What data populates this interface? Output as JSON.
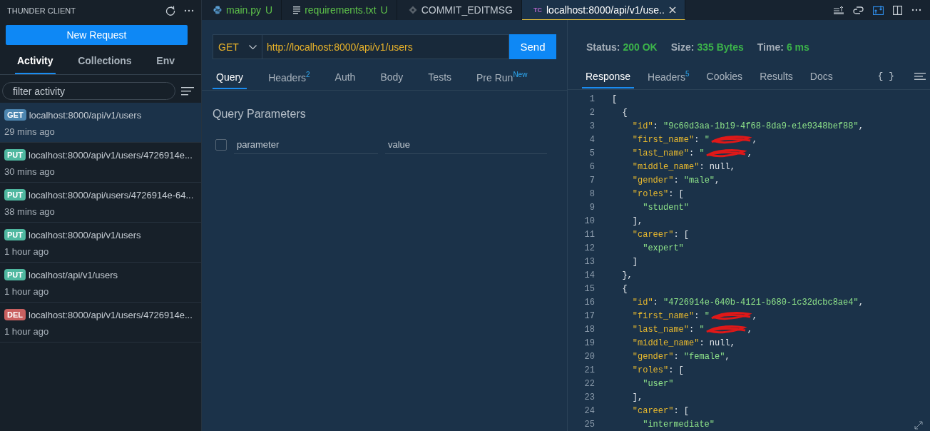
{
  "sidebar": {
    "title": "THUNDER CLIENT",
    "new_request": "New Request",
    "tabs": [
      {
        "label": "Activity",
        "selected": true
      },
      {
        "label": "Collections",
        "selected": false
      },
      {
        "label": "Env",
        "selected": false
      }
    ],
    "filter": {
      "placeholder": "filter activity"
    },
    "activity": [
      {
        "method": "GET",
        "url": "localhost:8000/api/v1/users",
        "time": "29 mins ago",
        "selected": true,
        "color": "#4d86b0"
      },
      {
        "method": "PUT",
        "url": "localhost:8000/api/v1/users/4726914e...",
        "time": "30 mins ago",
        "selected": false,
        "color": "#4fb8a0"
      },
      {
        "method": "PUT",
        "url": "localhost:8000/api/users/4726914e-64...",
        "time": "38 mins ago",
        "selected": false,
        "color": "#4fb8a0"
      },
      {
        "method": "PUT",
        "url": "localhost:8000/api/v1/users",
        "time": "1 hour ago",
        "selected": false,
        "color": "#4fb8a0"
      },
      {
        "method": "PUT",
        "url": "localhost/api/v1/users",
        "time": "1 hour ago",
        "selected": false,
        "color": "#4fb8a0"
      },
      {
        "method": "DEL",
        "url": "localhost:8000/api/v1/users/4726914e...",
        "time": "1 hour ago",
        "selected": false,
        "color": "#c96060"
      }
    ]
  },
  "editor_tabs": [
    {
      "kind": "python",
      "label": "main.py",
      "status": "U",
      "selected": false
    },
    {
      "kind": "text",
      "label": "requirements.txt",
      "status": "U",
      "selected": false
    },
    {
      "kind": "git",
      "label": "COMMIT_EDITMSG",
      "selected": false
    },
    {
      "kind": "thunder",
      "badge": "TC",
      "label": "localhost:8000/api/v1/use..",
      "selected": true
    }
  ],
  "request": {
    "method": "GET",
    "url": "http://localhost:8000/api/v1/users",
    "send": "Send",
    "tabs": [
      {
        "label": "Query",
        "selected": true
      },
      {
        "label": "Headers$^{2}$",
        "selected": false
      },
      {
        "label": "Auth",
        "selected": false
      },
      {
        "label": "Body",
        "selected": false
      },
      {
        "label": "Tests",
        "selected": false
      },
      {
        "label": "Pre Run$^{New}$",
        "selected": false
      }
    ],
    "section_title": "Query Parameters",
    "param_row": {
      "checked": false,
      "name_placeholder": "parameter",
      "value_placeholder": "value"
    }
  },
  "response": {
    "stats": [
      {
        "label": "Status:",
        "value": "200 OK"
      },
      {
        "label": "Size:",
        "value": "335 Bytes"
      },
      {
        "label": "Time:",
        "value": "6 ms"
      }
    ],
    "tabs": [
      {
        "label": "Response",
        "selected": true
      },
      {
        "label": "Headers$^{5}$",
        "selected": false
      },
      {
        "label": "Cookies",
        "selected": false
      },
      {
        "label": "Results",
        "selected": false
      },
      {
        "label": "Docs",
        "selected": false
      }
    ],
    "format_button": "{ }",
    "lines": [
      {
        "number": "1",
        "tokens": [
          {
            "kind": "punct",
            "text": "["
          }
        ]
      },
      {
        "number": "2",
        "tokens": [
          {
            "kind": "punct",
            "text": "  {"
          }
        ]
      },
      {
        "number": "3",
        "tokens": [
          {
            "kind": "key",
            "text": "    \"id\""
          },
          {
            "kind": "punct",
            "text": ": "
          },
          {
            "kind": "string",
            "text": "\"9c60d3aa-1b19-4f68-8da9-e1e9348bef88\""
          },
          {
            "kind": "punct",
            "text": ","
          }
        ]
      },
      {
        "number": "4",
        "tokens": [
          {
            "kind": "key",
            "text": "    \"first_name\""
          },
          {
            "kind": "punct",
            "text": ": "
          },
          {
            "kind": "string",
            "text": "\""
          },
          {
            "kind": "redacted"
          },
          {
            "kind": "punct",
            "text": ","
          }
        ]
      },
      {
        "number": "5",
        "tokens": [
          {
            "kind": "key",
            "text": "    \"last_name\""
          },
          {
            "kind": "punct",
            "text": ": "
          },
          {
            "kind": "string",
            "text": "\""
          },
          {
            "kind": "redacted"
          },
          {
            "kind": "punct",
            "text": ","
          }
        ]
      },
      {
        "number": "6",
        "tokens": [
          {
            "kind": "key",
            "text": "    \"middle_name\""
          },
          {
            "kind": "punct",
            "text": ": null,"
          }
        ]
      },
      {
        "number": "7",
        "tokens": [
          {
            "kind": "key",
            "text": "    \"gender\""
          },
          {
            "kind": "punct",
            "text": ": "
          },
          {
            "kind": "string",
            "text": "\"male\""
          },
          {
            "kind": "punct",
            "text": ","
          }
        ]
      },
      {
        "number": "8",
        "tokens": [
          {
            "kind": "key",
            "text": "    \"roles\""
          },
          {
            "kind": "punct",
            "text": ": ["
          }
        ]
      },
      {
        "number": "9",
        "tokens": [
          {
            "kind": "string",
            "text": "      \"student\""
          }
        ]
      },
      {
        "number": "10",
        "tokens": [
          {
            "kind": "punct",
            "text": "    ],"
          }
        ]
      },
      {
        "number": "11",
        "tokens": [
          {
            "kind": "key",
            "text": "    \"career\""
          },
          {
            "kind": "punct",
            "text": ": ["
          }
        ]
      },
      {
        "number": "12",
        "tokens": [
          {
            "kind": "string",
            "text": "      \"expert\""
          }
        ]
      },
      {
        "number": "13",
        "tokens": [
          {
            "kind": "punct",
            "text": "    ]"
          }
        ]
      },
      {
        "number": "14",
        "tokens": [
          {
            "kind": "punct",
            "text": "  },"
          }
        ]
      },
      {
        "number": "15",
        "tokens": [
          {
            "kind": "punct",
            "text": "  {"
          }
        ]
      },
      {
        "number": "16",
        "tokens": [
          {
            "kind": "key",
            "text": "    \"id\""
          },
          {
            "kind": "punct",
            "text": ": "
          },
          {
            "kind": "string",
            "text": "\"4726914e-640b-4121-b680-1c32dcbc8ae4\""
          },
          {
            "kind": "punct",
            "text": ","
          }
        ]
      },
      {
        "number": "17",
        "tokens": [
          {
            "kind": "key",
            "text": "    \"first_name\""
          },
          {
            "kind": "punct",
            "text": ": "
          },
          {
            "kind": "string",
            "text": "\""
          },
          {
            "kind": "redacted"
          },
          {
            "kind": "punct",
            "text": ","
          }
        ]
      },
      {
        "number": "18",
        "tokens": [
          {
            "kind": "key",
            "text": "    \"last_name\""
          },
          {
            "kind": "punct",
            "text": ": "
          },
          {
            "kind": "string",
            "text": "\""
          },
          {
            "kind": "redacted"
          },
          {
            "kind": "punct",
            "text": ","
          }
        ]
      },
      {
        "number": "19",
        "tokens": [
          {
            "kind": "key",
            "text": "    \"middle_name\""
          },
          {
            "kind": "punct",
            "text": ": null,"
          }
        ]
      },
      {
        "number": "20",
        "tokens": [
          {
            "kind": "key",
            "text": "    \"gender\""
          },
          {
            "kind": "punct",
            "text": ": "
          },
          {
            "kind": "string",
            "text": "\"female\""
          },
          {
            "kind": "punct",
            "text": ","
          }
        ]
      },
      {
        "number": "21",
        "tokens": [
          {
            "kind": "key",
            "text": "    \"roles\""
          },
          {
            "kind": "punct",
            "text": ": ["
          }
        ]
      },
      {
        "number": "22",
        "tokens": [
          {
            "kind": "string",
            "text": "      \"user\""
          }
        ]
      },
      {
        "number": "23",
        "tokens": [
          {
            "kind": "punct",
            "text": "    ],"
          }
        ]
      },
      {
        "number": "24",
        "tokens": [
          {
            "kind": "key",
            "text": "    \"career\""
          },
          {
            "kind": "punct",
            "text": ": ["
          }
        ]
      },
      {
        "number": "25",
        "tokens": [
          {
            "kind": "string",
            "text": "      \"intermediate\""
          }
        ]
      }
    ]
  }
}
